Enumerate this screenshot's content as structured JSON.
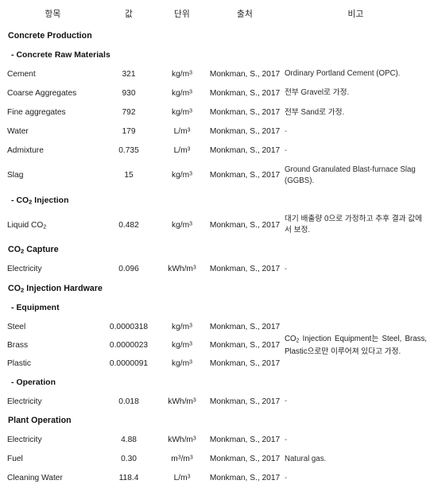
{
  "table": {
    "headers": [
      "항목",
      "값",
      "단위",
      "출처",
      "비고"
    ],
    "source_default": "Monkman, S., 2017",
    "units": {
      "kg_m3": "kg/m",
      "l_m3": "L/m",
      "kwh_m3": "kWh/m",
      "m3_m3": "m/m",
      "exp": "3"
    },
    "sections": [
      {
        "title": "Concrete Production",
        "subsections": [
          {
            "title": "- Concrete Raw Materials",
            "rows": [
              {
                "item": "Cement",
                "value": "321",
                "unit": "kg/m³",
                "source": "Monkman, S., 2017",
                "note": "Ordinary Portland Cement (OPC)."
              },
              {
                "item": "Coarse Aggregates",
                "value": "930",
                "unit": "kg/m³",
                "source": "Monkman, S., 2017",
                "note": "전부 Gravel로 가정."
              },
              {
                "item": "Fine aggregates",
                "value": "792",
                "unit": "kg/m³",
                "source": "Monkman, S., 2017",
                "note": "전부 Sand로 가정."
              },
              {
                "item": "Water",
                "value": "179",
                "unit": "L/m³",
                "source": "Monkman, S., 2017",
                "note": "-"
              },
              {
                "item": "Admixture",
                "value": "0.735",
                "unit": "L/m³",
                "source": "Monkman, S., 2017",
                "note": "-"
              },
              {
                "item": "Slag",
                "value": "15",
                "unit": "kg/m³",
                "source": "Monkman, S., 2017",
                "note": "Ground Granulated Blast-furnace Slag (GGBS)."
              }
            ]
          },
          {
            "title": "- CO₂ Injection",
            "rows": [
              {
                "item": "Liquid CO₂",
                "value": "0.482",
                "unit": "kg/m³",
                "source": "Monkman, S., 2017",
                "note": "대기 배출량 0으로 가정하고 추후 결과 값에서 보정."
              }
            ]
          }
        ]
      },
      {
        "title": "CO₂ Capture",
        "subsections": [
          {
            "title": "",
            "rows": [
              {
                "item": "Electricity",
                "value": "0.096",
                "unit": "kWh/m³",
                "source": "Monkman, S., 2017",
                "note": "-"
              }
            ]
          }
        ]
      },
      {
        "title": "CO₂ Injection Hardware",
        "subsections": [
          {
            "title": "- Equipment",
            "merged_note": "CO₂ Injection Equipment는 Steel, Brass, Plastic으로만 이루어져 있다고 가정.",
            "rows": [
              {
                "item": "Steel",
                "value": "0.0000318",
                "unit": "kg/m³",
                "source": "Monkman, S., 2017"
              },
              {
                "item": "Brass",
                "value": "0.0000023",
                "unit": "kg/m³",
                "source": "Monkman, S., 2017"
              },
              {
                "item": "Plastic",
                "value": "0.0000091",
                "unit": "kg/m³",
                "source": "Monkman, S., 2017"
              }
            ]
          },
          {
            "title": "- Operation",
            "rows": [
              {
                "item": "Electricity",
                "value": "0.018",
                "unit": "kWh/m³",
                "source": "Monkman, S., 2017",
                "note": "-"
              }
            ]
          }
        ]
      },
      {
        "title": "Plant Operation",
        "subsections": [
          {
            "title": "",
            "rows": [
              {
                "item": "Electricity",
                "value": "4.88",
                "unit": "kWh/m³",
                "source": "Monkman, S., 2017",
                "note": "-"
              },
              {
                "item": "Fuel",
                "value": "0.30",
                "unit": "m³/m³",
                "source": "Monkman, S., 2017",
                "note": "Natural gas."
              },
              {
                "item": "Cleaning Water",
                "value": "118.4",
                "unit": "L/m³",
                "source": "Monkman, S., 2017",
                "note": "-"
              }
            ]
          }
        ]
      }
    ],
    "rule_after_sections": [
      0,
      1
    ]
  }
}
